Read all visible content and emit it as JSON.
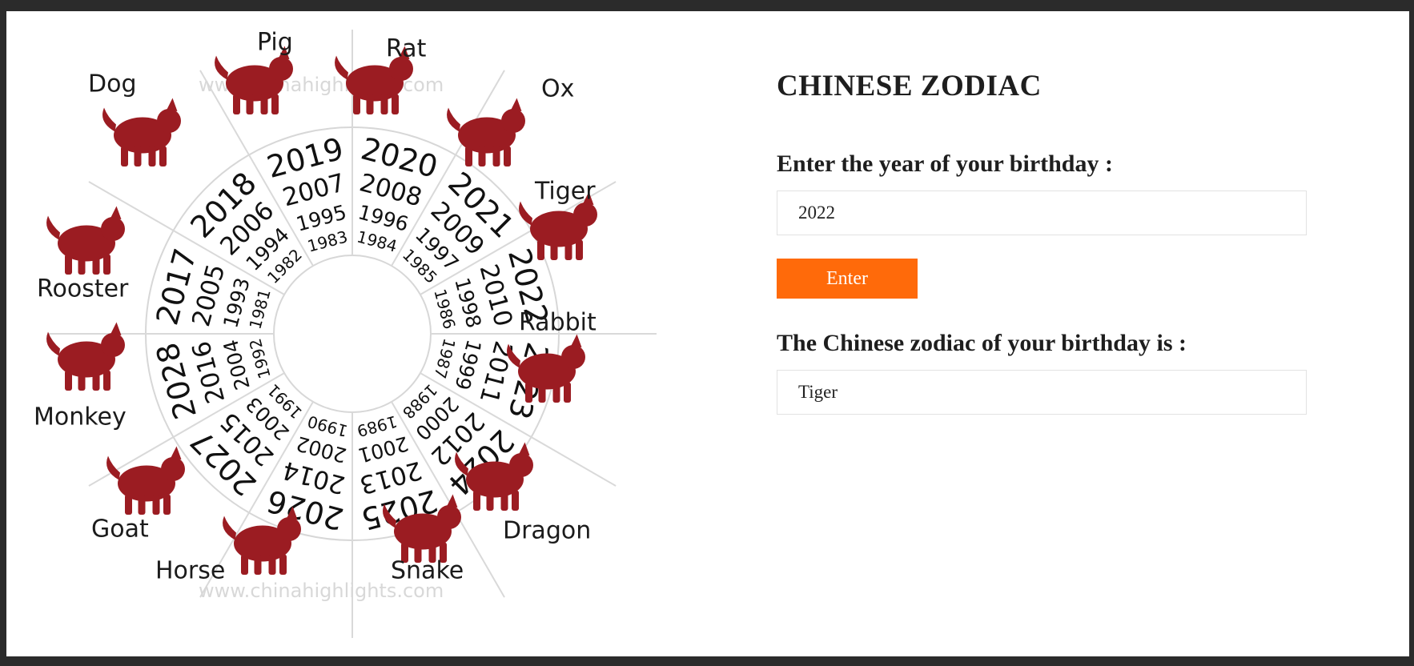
{
  "wheel": {
    "watermark": "www.chinahighlights.com",
    "sectors": [
      {
        "animal": "Tiger",
        "years": [
          "2022",
          "2010",
          "1998",
          "1986"
        ]
      },
      {
        "animal": "Rabbit",
        "years": [
          "2023",
          "2011",
          "1999",
          "1987"
        ]
      },
      {
        "animal": "Dragon",
        "years": [
          "2024",
          "2012",
          "2000",
          "1988"
        ]
      },
      {
        "animal": "Snake",
        "years": [
          "2025",
          "2013",
          "2001",
          "1989"
        ]
      },
      {
        "animal": "Horse",
        "years": [
          "2026",
          "2014",
          "2002",
          "1990"
        ]
      },
      {
        "animal": "Goat",
        "years": [
          "2027",
          "2015",
          "2003",
          "1991"
        ]
      },
      {
        "animal": "Monkey",
        "years": [
          "2028",
          "2016",
          "2004",
          "1992"
        ]
      },
      {
        "animal": "Rooster",
        "years": [
          "2017",
          "2005",
          "1993",
          "1981"
        ]
      },
      {
        "animal": "Dog",
        "years": [
          "2018",
          "2006",
          "1994",
          "1982"
        ]
      },
      {
        "animal": "Pig",
        "years": [
          "2019",
          "2007",
          "1995",
          "1983"
        ]
      },
      {
        "animal": "Rat",
        "years": [
          "2020",
          "2008",
          "1996",
          "1984"
        ]
      },
      {
        "animal": "Ox",
        "years": [
          "2021",
          "2009",
          "1997",
          "1985"
        ]
      }
    ],
    "silhouette_color": "#9b1c22"
  },
  "page": {
    "title": "CHINESE ZODIAC",
    "year_label": "Enter the year of your birthday :",
    "year_value": "2022",
    "enter_label": "Enter",
    "result_label": "The Chinese zodiac of your birthday is :",
    "result_value": "Tiger"
  },
  "colors": {
    "accent": "#ff6a0a",
    "frame": "#2b2b2b",
    "text": "#1e1e1e"
  }
}
